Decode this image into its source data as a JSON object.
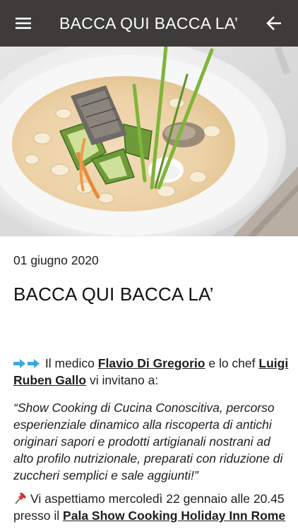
{
  "appbar": {
    "title": "BACCA QUI BACCA LA’",
    "menu_icon": "hamburger-menu-icon",
    "back_icon": "arrow-back-icon",
    "background": "#3d3c3a",
    "text_color": "#ffffff"
  },
  "hero": {
    "description_icon": "dish-photo"
  },
  "article": {
    "date": "01 giugno 2020",
    "title": "BACCA QUI BACCA LA’",
    "intro": {
      "lead_icon": "right-arrow-emoji",
      "text_1": "Il medico",
      "doctor_link": "Flavio Di Gregorio",
      "text_2": "e lo chef",
      "chef_link": "Luigi Ruben Gallo",
      "text_3": "vi invitano a:"
    },
    "quote": "“Show Cooking di Cucina Conoscitiva, percorso esperienziale dinamico alla riscoperta di antichi originari sapori e prodotti artigianali nostrani ad alto profilo nutrizionale, preparati con riduzione di zuccheri semplici e sale aggiunti!”",
    "event": {
      "lead_icon": "pushpin-emoji",
      "text": "Vi aspettiamo mercoledì 22 gennaio alle 20.45 presso il",
      "venue_link": "Pala Show Cooking Holiday Inn Rome"
    }
  }
}
